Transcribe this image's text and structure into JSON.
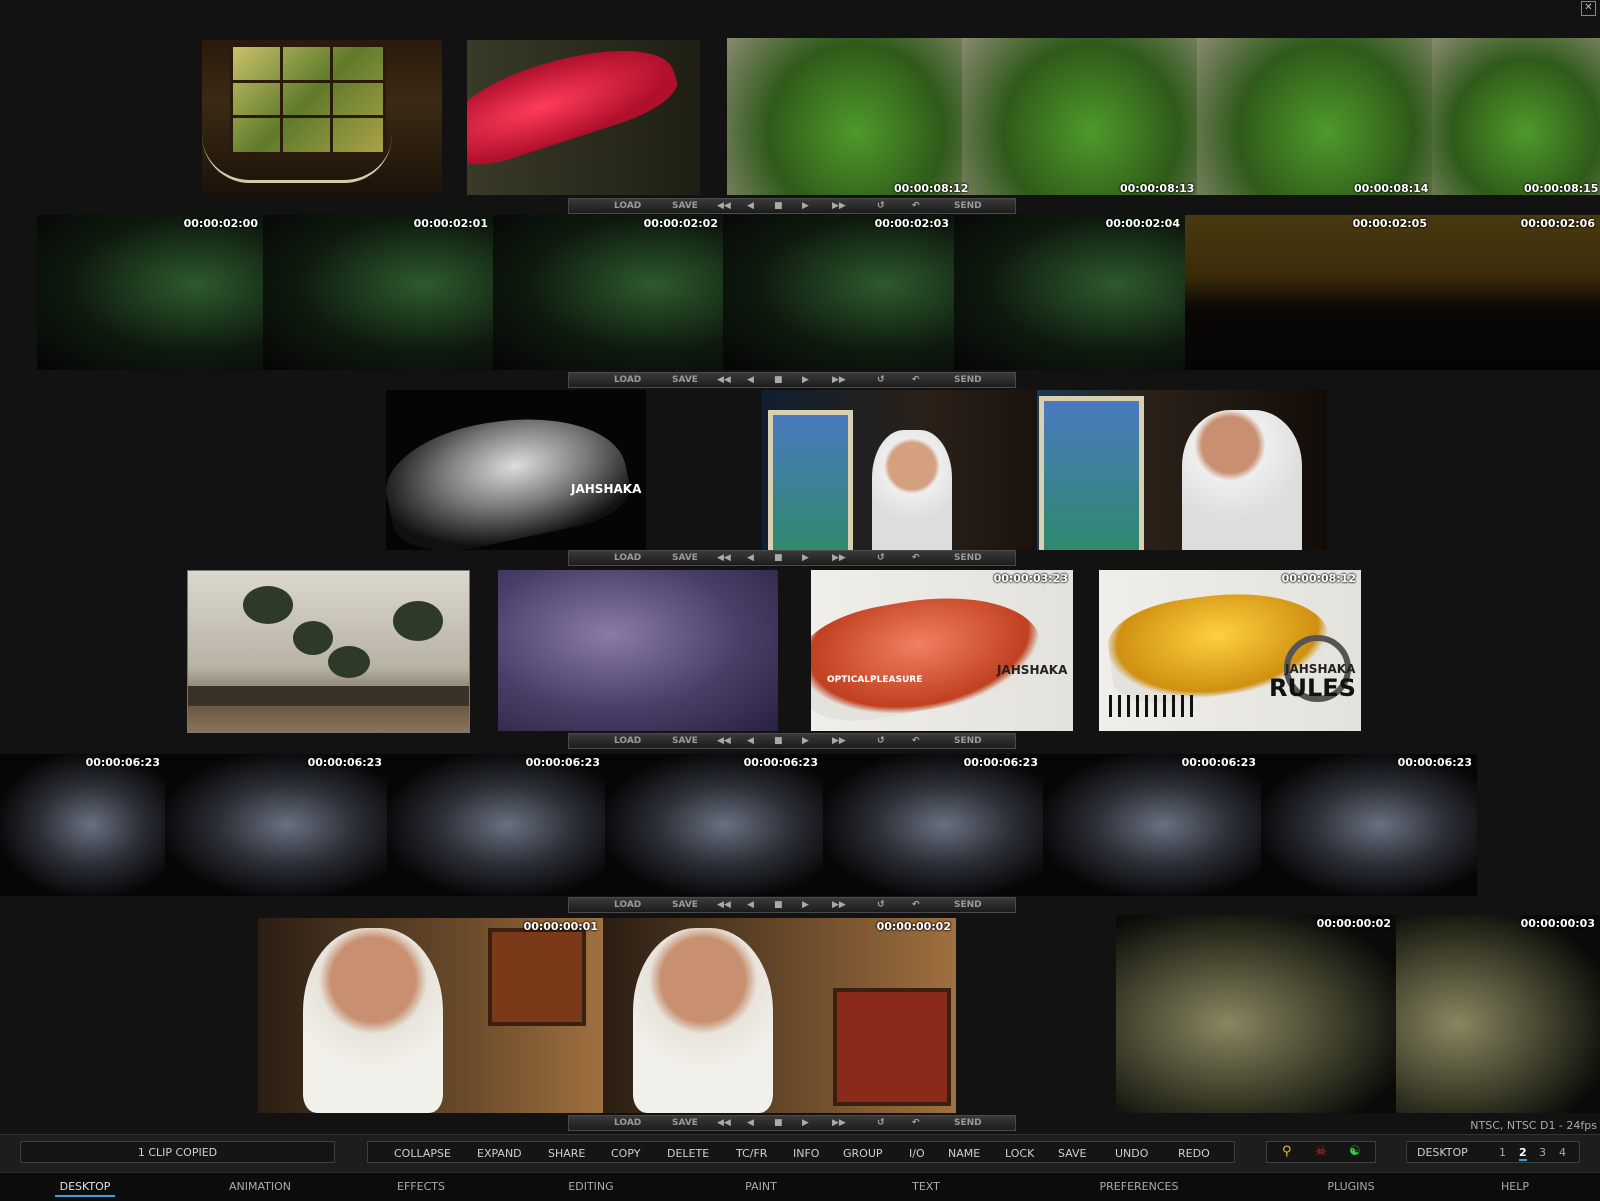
{
  "window": {
    "close_label": "✕"
  },
  "transport": {
    "load": "LOAD",
    "save": "SAVE",
    "send": "SEND"
  },
  "row1": {
    "strip_timecodes": [
      "00:00:08:12",
      "00:00:08:13",
      "00:00:08:14",
      "00:00:08:15"
    ]
  },
  "row2": {
    "timecodes": [
      "00:00:02:00",
      "00:00:02:01",
      "00:00:02:02",
      "00:00:02:03",
      "00:00:02:04",
      "00:00:02:05",
      "00:00:02:06"
    ]
  },
  "row3": {
    "logo_text": "JAHSHAKA"
  },
  "row4": {
    "clip3": {
      "timecode": "00:00:03:23",
      "text1": "OPTICALPLEASURE",
      "text2": "JAHSHAKA"
    },
    "clip4": {
      "timecode": "00:00:08:12",
      "text1": "JAHSHAKA",
      "text2": "RULES"
    }
  },
  "row5": {
    "timecodes": [
      "00:00:06:23",
      "00:00:06:23",
      "00:00:06:23",
      "00:00:06:23",
      "00:00:06:23",
      "00:00:06:23",
      "00:00:06:23"
    ]
  },
  "row6": {
    "left_timecodes": [
      "00:00:00:01",
      "00:00:00:02"
    ],
    "right_timecodes": [
      "00:00:00:02",
      "00:00:00:03"
    ]
  },
  "format_info": "NTSC, NTSC D1 - 24fps",
  "status": {
    "message": "1 CLIP COPIED"
  },
  "menu": [
    "COLLAPSE",
    "EXPAND",
    "SHARE",
    "COPY",
    "DELETE",
    "TC/FR",
    "INFO",
    "GROUP",
    "I/O",
    "NAME",
    "LOCK",
    "SAVE",
    "UNDO",
    "REDO"
  ],
  "desktop": {
    "label": "DESKTOP",
    "pages": [
      "1",
      "2",
      "3",
      "4"
    ],
    "active_page": "2"
  },
  "tool_icons": [
    "bike-icon",
    "figure-icon",
    "yin-yang-icon"
  ],
  "colors": {
    "accent": "#3aa0d8",
    "background": "#121212"
  },
  "nav": [
    "DESKTOP",
    "ANIMATION",
    "EFFECTS",
    "EDITING",
    "PAINT",
    "TEXT",
    "PREFERENCES",
    "PLUGINS",
    "HELP"
  ],
  "active_nav": "DESKTOP"
}
